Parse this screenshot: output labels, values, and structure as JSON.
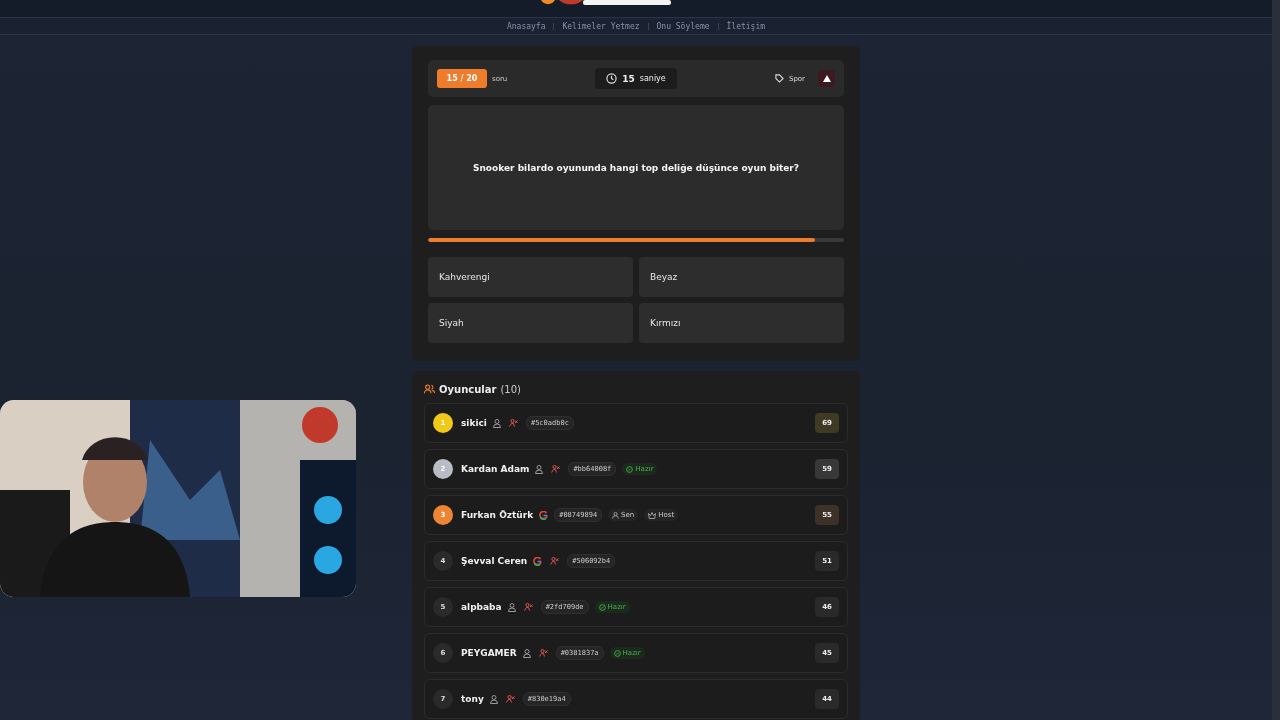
{
  "nav": {
    "items": [
      {
        "label": "Anasayfa"
      },
      {
        "label": "Kelimeler Yetmez"
      },
      {
        "label": "Onu Söyleme"
      },
      {
        "label": "İletişim"
      }
    ]
  },
  "quiz": {
    "counter": "15 / 20",
    "counter_label": "soru",
    "timer_value": "15",
    "timer_unit": "saniye",
    "category": "Spor",
    "question": "Snooker bilardo oyununda hangi top deliğe düşünce oyun biter?",
    "time_bar": {
      "level": 0.93
    },
    "answers": [
      {
        "label": "Kahverengi",
        "selected": false
      },
      {
        "label": "Beyaz",
        "selected": false
      },
      {
        "label": "Siyah",
        "selected": false
      },
      {
        "label": "Kırmızı",
        "selected": false
      }
    ]
  },
  "players": {
    "title": "Oyuncular",
    "count": "(10)",
    "items": [
      {
        "rank": "1",
        "color": "#f2c919",
        "name": "sikici",
        "kind": "guest",
        "kickable": true,
        "id": "#5c0adb0c",
        "score": "69"
      },
      {
        "rank": "2",
        "color": "#b9bcc4",
        "name": "Kardan Adam",
        "kind": "guest",
        "kickable": true,
        "id": "#bb64008f",
        "tags": [
          {
            "kind": "ready",
            "label": "Hazır"
          }
        ],
        "score": "59"
      },
      {
        "rank": "3",
        "color": "#ee8535",
        "name": "Furkan Öztürk",
        "kind": "google",
        "kickable": false,
        "id": "#08749894",
        "tags": [
          {
            "kind": "you",
            "label": "Sen"
          },
          {
            "kind": "host",
            "label": "Host"
          }
        ],
        "score": "55"
      },
      {
        "rank": "4",
        "name": "Şevval Ceren",
        "kind": "google",
        "kickable": true,
        "id": "#506092b4",
        "score": "51"
      },
      {
        "rank": "5",
        "name": "alpbaba",
        "kind": "guest",
        "kickable": true,
        "id": "#2fd709de",
        "tags": [
          {
            "kind": "ready",
            "label": "Hazır"
          }
        ],
        "score": "46"
      },
      {
        "rank": "6",
        "name": "PEYGAMER",
        "kind": "guest",
        "kickable": true,
        "id": "#0381837a",
        "tags": [
          {
            "kind": "ready",
            "label": "Hazır"
          }
        ],
        "score": "45"
      },
      {
        "rank": "7",
        "name": "tony",
        "kind": "guest",
        "kickable": true,
        "id": "#830e19a4",
        "score": "44"
      }
    ]
  }
}
